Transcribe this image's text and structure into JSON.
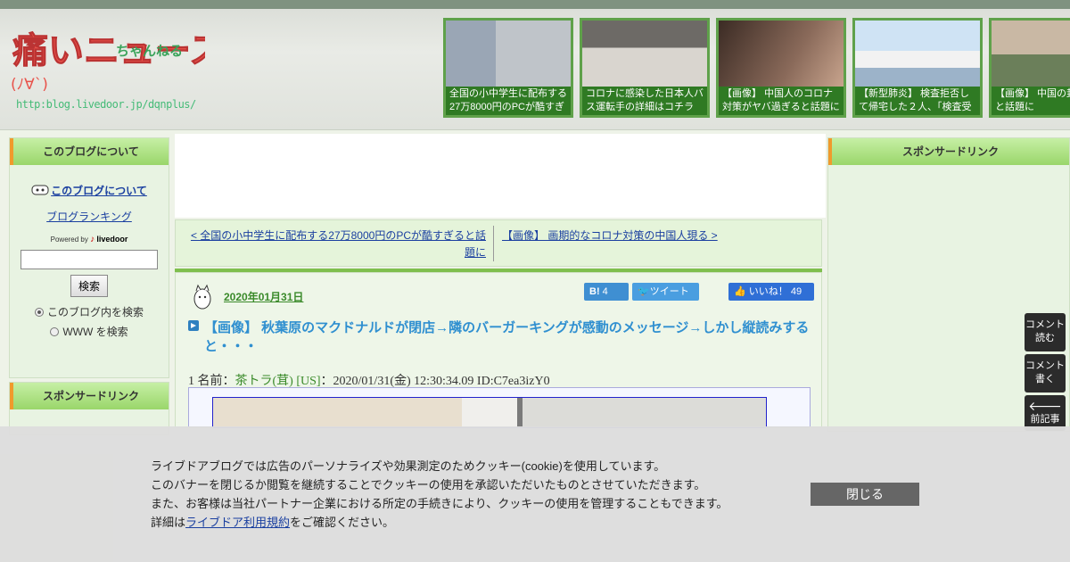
{
  "header": {
    "logo": {
      "title": "痛いニュース",
      "kaomoji": "(ﾉ∀`)",
      "subtitle": "ちゃんねる",
      "url": "http:blog.livedoor.jp/dqnplus/"
    },
    "thumbnails": [
      {
        "caption": "全国の小中学生に配布する27万8000円のPCが酷すぎ"
      },
      {
        "caption": "コロナに感染した日本人バス運転手の詳細はコチラ"
      },
      {
        "caption": "【画像】 中国人のコロナ対策がヤバ過ぎると話題に"
      },
      {
        "caption": "【新型肺炎】 検査拒否して帰宅した２人、「検査受け"
      },
      {
        "caption": "【画像】 中国の封鎖ぎると話題に"
      }
    ]
  },
  "left_sidebar": {
    "heading": "このブログについて",
    "about_link": "このブログについて",
    "ranking_link": "ブログランキング",
    "powered_by": "Powered by",
    "powered_brand": "livedoor",
    "search_value": "",
    "search_button": "検索",
    "radio_blog": "このブログ内を検索",
    "radio_www": "WWW を検索",
    "sponsor_heading": "スポンサードリンク"
  },
  "navigation": {
    "prev": "< 全国の小中学生に配布する27万8000円のPCが酷すぎると話題に",
    "next": "【画像】 画期的なコロナ対策の中国人現る >"
  },
  "article": {
    "date": "2020年01月31日",
    "hatena_count": "4",
    "tweet_label": "ツイート",
    "like_label": "いいね！",
    "like_count": "49",
    "title": "【画像】 秋葉原のマクドナルドが閉店→隣のバーガーキングが感動のメッセージ→しかし縦読みすると・・・",
    "reply_prefix": "1 名前：",
    "reply_name": "茶トラ(茸) [US]",
    "reply_meta": "：2020/01/31(金) 12:30:34.09 ID:C7ea3izY0"
  },
  "right_sidebar": {
    "heading": "スポンサードリンク"
  },
  "side_buttons": {
    "read_comments": "コメント読む",
    "write_comment": "コメント書く",
    "prev_article": "前記事"
  },
  "cookie_banner": {
    "line1": "ライブドアブログでは広告のパーソナライズや効果測定のためクッキー(cookie)を使用しています。",
    "line2": "このバナーを閉じるか閲覧を継続することでクッキーの使用を承認いただいたものとさせていただきます。",
    "line3": "また、お客様は当社パートナー企業における所定の手続きにより、クッキーの使用を管理することもできます。",
    "line4_prefix": "詳細は",
    "line4_link": "ライブドア利用規約",
    "line4_suffix": "をご確認ください。",
    "close_button": "閉じる"
  }
}
